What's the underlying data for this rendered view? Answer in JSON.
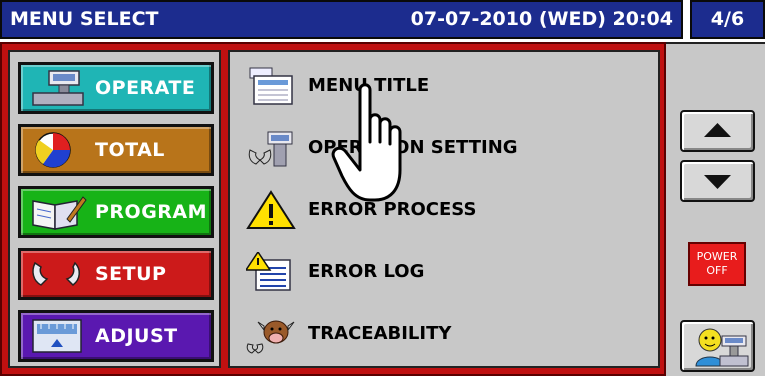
{
  "header": {
    "title": "MENU SELECT",
    "datetime": "07-07-2010 (WED) 20:04",
    "page_indicator": "4/6"
  },
  "categories": [
    {
      "label": "OPERATE",
      "color": "#1fb5b5",
      "icon": "scale-icon"
    },
    {
      "label": "TOTAL",
      "color": "#b8741a",
      "icon": "pie-chart-icon"
    },
    {
      "label": "PROGRAM",
      "color": "#17b317",
      "icon": "book-pen-icon"
    },
    {
      "label": "SETUP",
      "color": "#cc1a1a",
      "icon": "wrench-icon"
    },
    {
      "label": "ADJUST",
      "color": "#5a18b0",
      "icon": "adjust-scale-icon"
    }
  ],
  "menu_items": [
    {
      "label": "MENU TITLE",
      "icon": "menu-title-icon"
    },
    {
      "label": "OPERATION SETTING",
      "icon": "operation-setting-icon"
    },
    {
      "label": "ERROR PROCESS",
      "icon": "warning-icon"
    },
    {
      "label": "ERROR LOG",
      "icon": "error-log-icon"
    },
    {
      "label": "TRACEABILITY",
      "icon": "cow-icon"
    }
  ],
  "side": {
    "power_label_line1": "POWER",
    "power_label_line2": "OFF"
  }
}
